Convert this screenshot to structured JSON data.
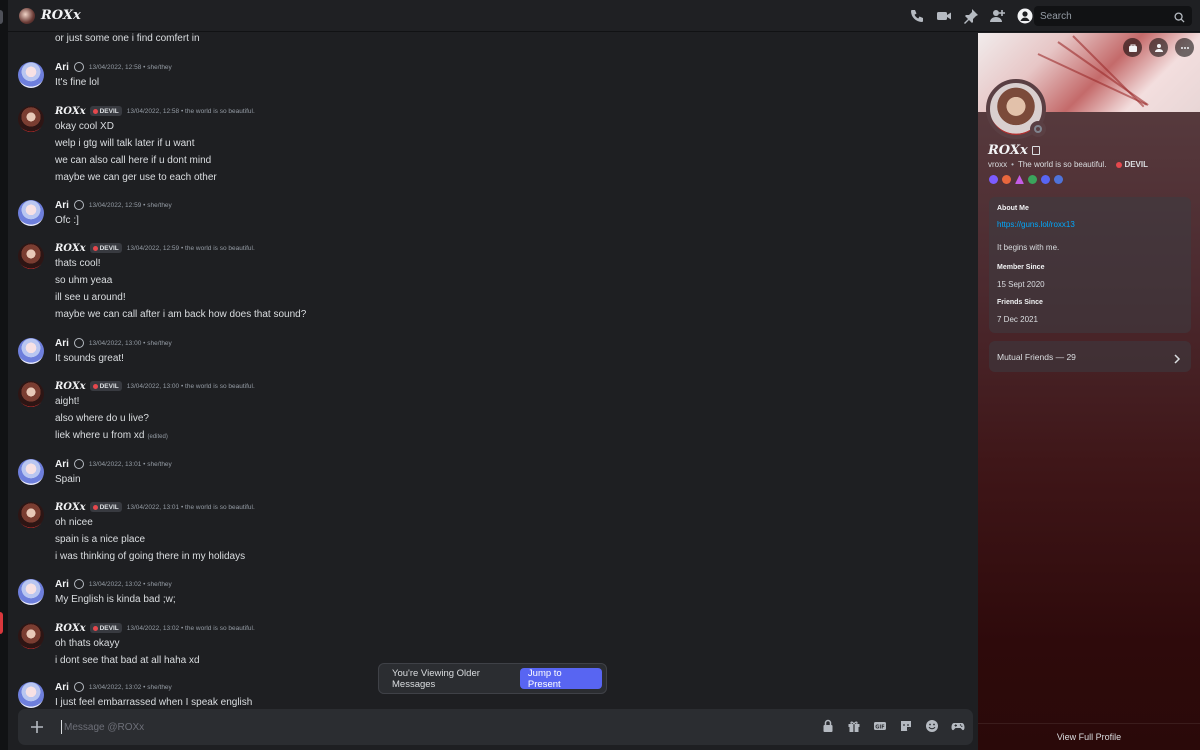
{
  "header": {
    "title": "ROXx",
    "icons": [
      "phone-call-icon",
      "video-call-icon",
      "pin-icon",
      "add-friend-icon",
      "user-profile-icon"
    ],
    "search_placeholder": "Search"
  },
  "chat": {
    "top_continuation": "or just some one i find comfert in",
    "messages": [
      {
        "author": "Ari",
        "time": "13/04/2022, 12:58",
        "note": "• she/they",
        "lines": [
          "It's fine lol"
        ]
      },
      {
        "author": "ROXx",
        "tag": "DEVIL",
        "time": "13/04/2022, 12:58",
        "note": "• the world is so beautiful.",
        "lines": [
          "okay cool XD",
          "welp i gtg will talk later if u want",
          "we can also call here if u dont mind",
          "maybe we can ger use to each other"
        ]
      },
      {
        "author": "Ari",
        "time": "13/04/2022, 12:59",
        "note": "• she/they",
        "lines": [
          "Ofc :]"
        ]
      },
      {
        "author": "ROXx",
        "tag": "DEVIL",
        "time": "13/04/2022, 12:59",
        "note": "• the world is so beautiful.",
        "lines": [
          "thats cool!",
          "so uhm yeaa",
          "ill see u around!",
          "maybe we can call after i am back how does that sound?"
        ]
      },
      {
        "author": "Ari",
        "time": "13/04/2022, 13:00",
        "note": "• she/they",
        "lines": [
          "It sounds great!"
        ]
      },
      {
        "author": "ROXx",
        "tag": "DEVIL",
        "time": "13/04/2022, 13:00",
        "note": "• the world is so beautiful.",
        "lines": [
          "aight!",
          "also where do u live?",
          "liek where u from xd"
        ],
        "edited": "(edited)"
      },
      {
        "author": "Ari",
        "time": "13/04/2022, 13:01",
        "note": "• she/they",
        "lines": [
          "Spain"
        ]
      },
      {
        "author": "ROXx",
        "tag": "DEVIL",
        "time": "13/04/2022, 13:01",
        "note": "• the world is so beautiful.",
        "lines": [
          "oh nicee",
          "spain is a nice place",
          "i was thinking of going there in my holidays"
        ]
      },
      {
        "author": "Ari",
        "time": "13/04/2022, 13:02",
        "note": "• she/they",
        "lines": [
          "My English is kinda bad ;w;"
        ]
      },
      {
        "author": "ROXx",
        "tag": "DEVIL",
        "time": "13/04/2022, 13:02",
        "note": "• the world is so beautiful.",
        "lines": [
          "oh thats okayy",
          "i dont see that bad at all haha xd"
        ]
      },
      {
        "author": "Ari",
        "time": "13/04/2022, 13:02",
        "note": "• she/they",
        "lines": [
          "I just feel embarrassed when I speak english"
        ]
      }
    ],
    "older_notice": "You're Viewing Older Messages",
    "jump_label": "Jump to Present",
    "composer_placeholder": "Message @ROXx",
    "composer_icons": [
      "lock-icon",
      "gift-icon",
      "gif-icon",
      "sticker-icon",
      "emoji-icon",
      "game-controller-icon"
    ]
  },
  "profile": {
    "display_name": "ROXx",
    "username": "vroxx",
    "status": "The world is so beautiful.",
    "tag": "DEVIL",
    "badge_colors": [
      "#7c5cff",
      "#e8673d",
      "#c45de5",
      "#3ba55c",
      "#5865f2",
      "#4f73d9"
    ],
    "about_label": "About Me",
    "about_link": "https://guns.lol/roxx13",
    "about_text": "It begins with me.",
    "member_since_label": "Member Since",
    "member_since": "15 Sept 2020",
    "friends_since_label": "Friends Since",
    "friends_since": "7 Dec 2021",
    "mutual_friends": "Mutual Friends — 29",
    "view_full": "View Full Profile"
  },
  "colors": {
    "accent": "#5865f2",
    "link": "#00a8fc",
    "background": "#1e1f22",
    "tag_dot": "#e5484d"
  }
}
